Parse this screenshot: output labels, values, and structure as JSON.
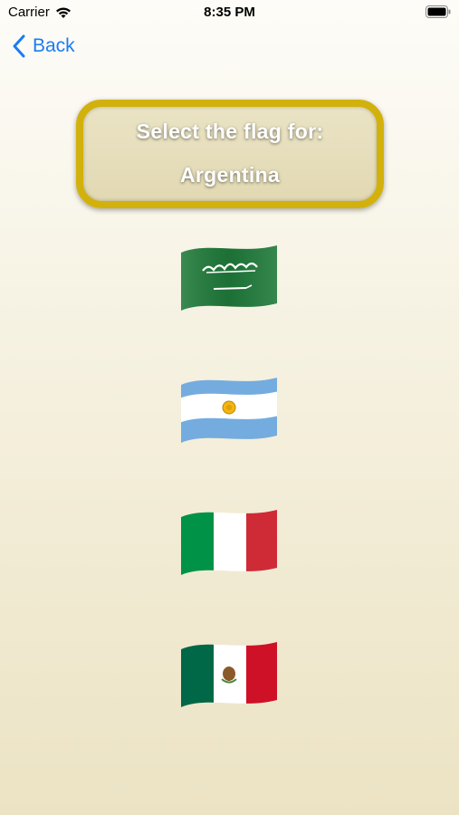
{
  "status_bar": {
    "carrier": "Carrier",
    "time": "8:35 PM"
  },
  "nav": {
    "back_label": "Back"
  },
  "prompt": {
    "line1": "Select the flag for:",
    "line2": "Argentina"
  },
  "flags": [
    {
      "country_icon": "saudi-arabia-flag-icon",
      "colors": [
        "#1f7a3a",
        "#ffffff"
      ]
    },
    {
      "country_icon": "argentina-flag-icon",
      "colors": [
        "#74acdf",
        "#ffffff",
        "#f6b40e"
      ]
    },
    {
      "country_icon": "italy-flag-icon",
      "colors": [
        "#009246",
        "#ffffff",
        "#ce2b37"
      ]
    },
    {
      "country_icon": "mexico-flag-icon",
      "colors": [
        "#006847",
        "#ffffff",
        "#ce1126"
      ]
    }
  ],
  "colors": {
    "accent": "#1a7cf5",
    "prompt_border": "#d2b10c"
  }
}
